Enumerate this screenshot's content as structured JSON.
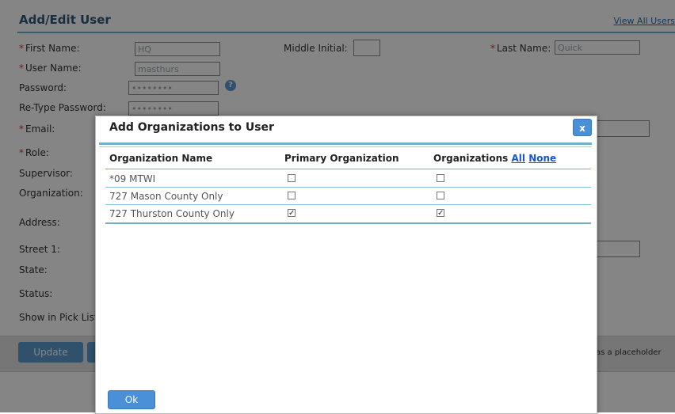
{
  "page": {
    "title": "Add/Edit User",
    "view_all_link": "View All Users",
    "labels": {
      "first_name": "First Name:",
      "middle_initial": "Middle Initial:",
      "last_name": "Last Name:",
      "user_name": "User Name:",
      "password": "Password:",
      "retype_password": "Re-Type Password:",
      "email": "Email:",
      "role": "Role:",
      "supervisor": "Supervisor:",
      "organization": "Organization:",
      "address": "Address:",
      "street1": "Street 1:",
      "state": "State:",
      "status": "Status:",
      "show_in_pick_list": "Show in Pick List"
    },
    "values": {
      "first_name": "HQ",
      "middle_initial": "",
      "last_name": "Quick",
      "user_name": "masthurs",
      "password": "••••••••",
      "retype_password": "••••••••"
    },
    "required_marker": "*",
    "help_icon": "?",
    "update_button": "Update",
    "placeholder_note": "as a placeholder"
  },
  "modal": {
    "title": "Add Organizations to User",
    "close_label": "x",
    "columns": {
      "name": "Organization Name",
      "primary": "Primary Organization",
      "organizations": "Organizations",
      "all_link": "All",
      "none_link": "None"
    },
    "rows": [
      {
        "name": "*09 MTWI",
        "primary": false,
        "included": false
      },
      {
        "name": "727 Mason County Only",
        "primary": false,
        "included": false
      },
      {
        "name": "727 Thurston County Only",
        "primary": true,
        "included": true
      }
    ],
    "ok_label": "Ok"
  }
}
